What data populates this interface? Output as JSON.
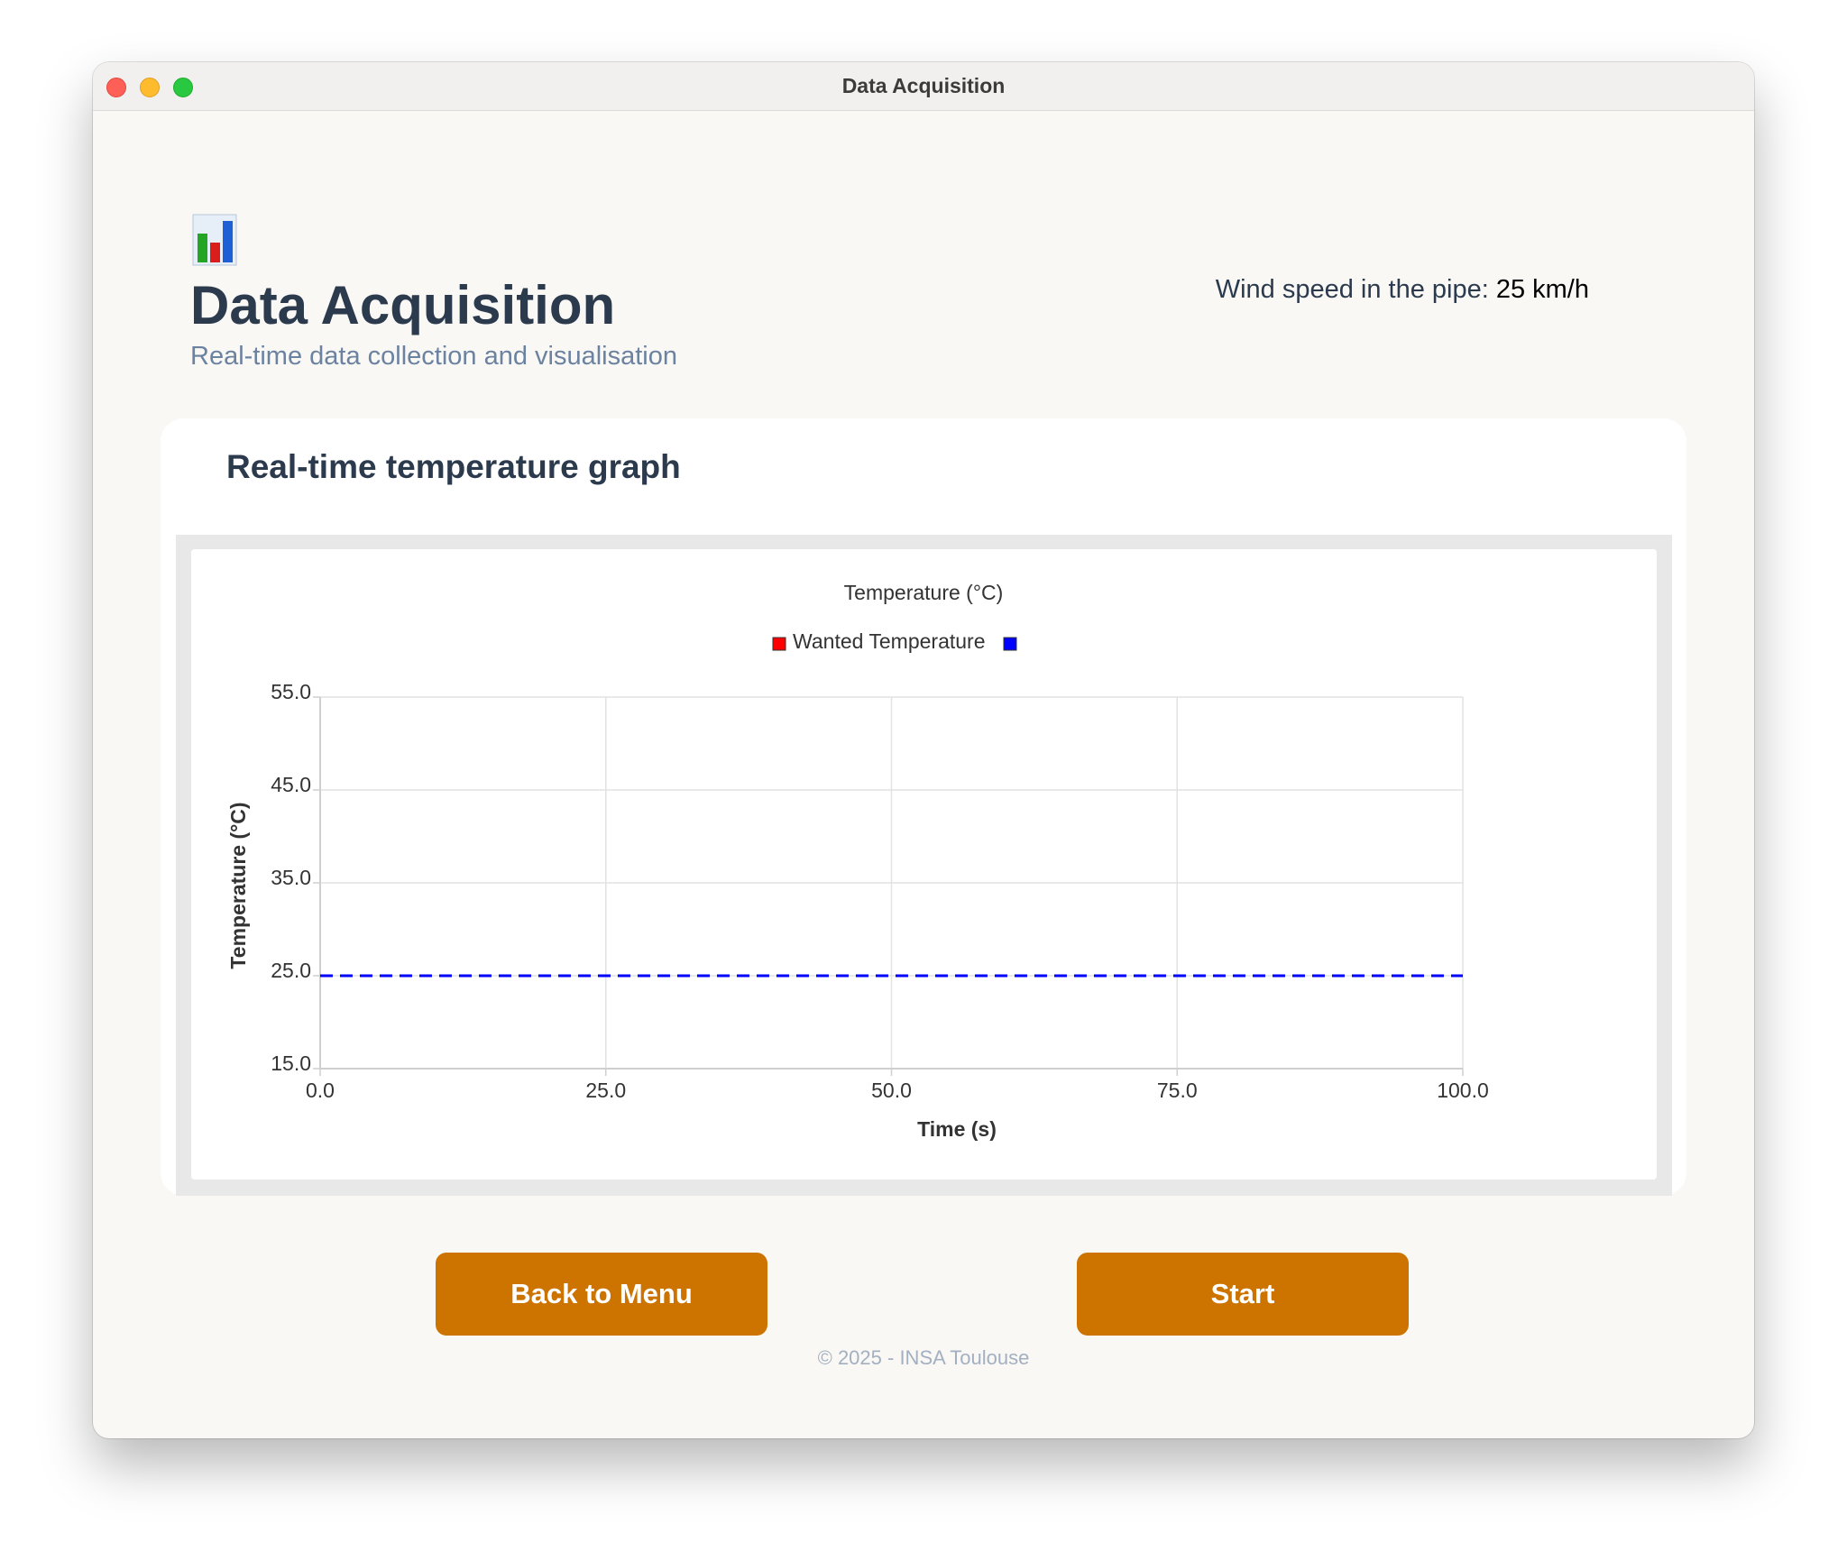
{
  "window": {
    "title": "Data Acquisition"
  },
  "header": {
    "icon": "bar-chart-icon",
    "title": "Data Acquisition",
    "subtitle": "Real-time data collection and visualisation",
    "wind_label": "Wind speed in the pipe:",
    "wind_value": "25 km/h"
  },
  "card": {
    "title": "Real-time temperature graph"
  },
  "chart_data": {
    "type": "line",
    "title": "Temperature (°C)",
    "xlabel": "Time (s)",
    "ylabel": "Temperature (°C)",
    "xlim": [
      0,
      100
    ],
    "ylim": [
      15,
      55
    ],
    "x_ticks": [
      "0.0",
      "25.0",
      "50.0",
      "75.0",
      "100.0"
    ],
    "y_ticks": [
      "15.0",
      "25.0",
      "35.0",
      "45.0",
      "55.0"
    ],
    "grid": true,
    "legend": "top-center",
    "series": [
      {
        "name": "Wanted Temperature",
        "color": "#ff0000",
        "line_style": "solid",
        "x": [],
        "y": []
      },
      {
        "name": "",
        "color": "#0000ff",
        "line_style": "dashed",
        "x": [
          0,
          100
        ],
        "y": [
          25,
          25
        ]
      }
    ]
  },
  "buttons": {
    "back_label": "Back to Menu",
    "start_label": "Start"
  },
  "footer": {
    "text": "© 2025 - INSA Toulouse"
  },
  "colors": {
    "accent": "#cc7300",
    "title_text": "#2c3a4d",
    "subtitle_text": "#6b82a0"
  }
}
